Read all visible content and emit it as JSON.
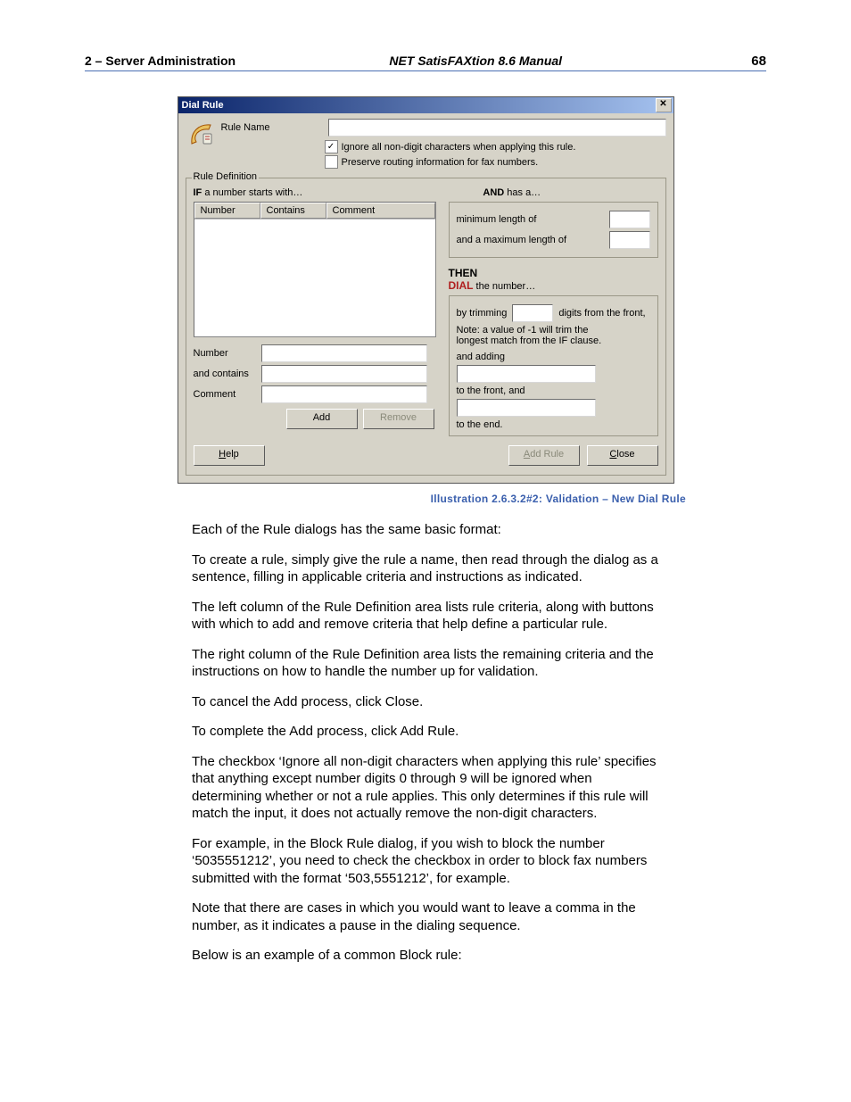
{
  "header": {
    "left": "2  – Server Administration",
    "center": "NET SatisFAXtion 8.6 Manual",
    "right": "68"
  },
  "dialog": {
    "title": "Dial Rule",
    "rule_name_label": "Rule Name",
    "rule_name_value": "",
    "cb_ignore_label": "Ignore all non-digit characters when applying this rule.",
    "cb_preserve_label": "Preserve routing information for fax numbers.",
    "cb_ignore_checked": true,
    "cb_preserve_checked": false,
    "rule_def_legend": "Rule Definition",
    "if_label": "IF",
    "if_text": " a number starts with…",
    "and_label": "AND",
    "and_text": " has a…",
    "lv_cols": [
      "Number",
      "Contains",
      "Comment"
    ],
    "min_len_label": "minimum length of",
    "max_len_label": "and a maximum length of",
    "then_label": "THEN",
    "dial_label": "DIAL",
    "dial_text": " the number…",
    "trim_label_a": "by trimming",
    "trim_label_b": "digits from the front,",
    "trim_note_a": "Note: a value of -1 will trim the",
    "trim_note_b": "longest match from the IF clause.",
    "adding_label": "and adding",
    "to_front_label": "to the front, and",
    "to_end_label": "to the end.",
    "form_number": "Number",
    "form_contains": "and contains",
    "form_comment": "Comment",
    "btn_add": "Add",
    "btn_remove": "Remove",
    "btn_help": "Help",
    "btn_add_rule": "Add Rule",
    "btn_close": "Close"
  },
  "caption": "Illustration 2.6.3.2#2: Validation – New Dial Rule",
  "paragraphs": {
    "p1": "Each of the Rule dialogs has the same basic format:",
    "p2": "To create a rule, simply give the rule a name, then read through the dialog as a sentence, filling in applicable criteria and instructions as indicated.",
    "p3": "The left column of the Rule Definition area lists rule criteria, along with buttons with which to add and remove criteria that help define a particular rule.",
    "p4": "The right column of the Rule Definition area lists the remaining criteria and the instructions on how to handle the number up for validation.",
    "p5": "To cancel the Add process, click Close.",
    "p6": "To complete the Add process, click Add Rule.",
    "p7": "The checkbox ‘Ignore all non-digit characters when applying this rule’ specifies that anything except number digits 0 through 9 will be ignored when determining whether or not a rule applies. This only determines if this rule will match the input, it does not actually remove the non-digit characters.",
    "p8": "For example, in the Block Rule dialog, if you wish to block the number ‘5035551212’, you need to check the checkbox in order to block fax numbers submitted with the format ‘503,5551212’, for example.",
    "p9": "Note that there are cases in which you would want to leave a comma in the number, as it indicates a pause in the dialing sequence.",
    "p10": "Below is an example of a common Block rule:"
  }
}
